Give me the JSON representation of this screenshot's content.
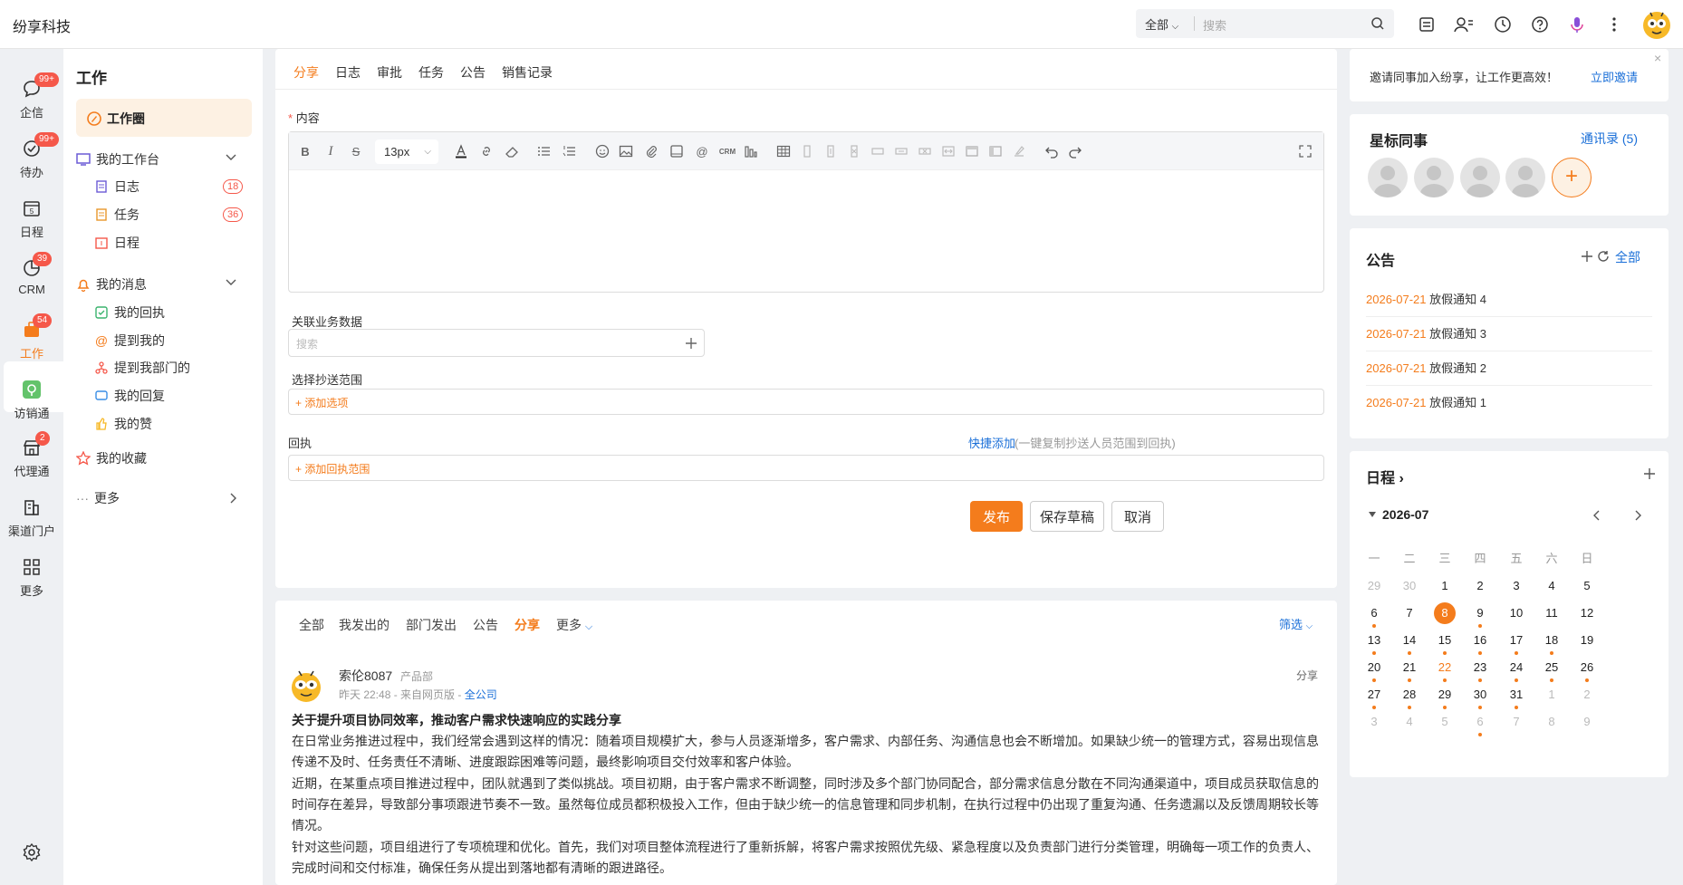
{
  "app": {
    "title": "纷享科技"
  },
  "topbar": {
    "scope": "全部",
    "search_placeholder": "搜索"
  },
  "rail": {
    "items": [
      {
        "label": "企信",
        "badge": "99+"
      },
      {
        "label": "待办",
        "badge": "99+"
      },
      {
        "label": "日程",
        "calendar_day": "5"
      },
      {
        "label": "CRM",
        "badge": "39"
      },
      {
        "label": "工作",
        "badge": "54"
      },
      {
        "label": "访销通"
      },
      {
        "label": "代理通",
        "badge": "2"
      },
      {
        "label": "渠道门户"
      },
      {
        "label": "更多"
      }
    ]
  },
  "subnav": {
    "title": "工作",
    "work_circle": "工作圈",
    "workbench": {
      "label": "我的工作台",
      "items": [
        {
          "label": "日志",
          "count": "18"
        },
        {
          "label": "任务",
          "count": "36"
        },
        {
          "label": "日程"
        }
      ]
    },
    "messages": {
      "label": "我的消息",
      "items": [
        {
          "label": "我的回执"
        },
        {
          "label": "提到我的"
        },
        {
          "label": "提到我部门的"
        },
        {
          "label": "我的回复"
        },
        {
          "label": "我的赞"
        }
      ]
    },
    "favorites": "我的收藏",
    "more_dots": "···",
    "more": "更多"
  },
  "editor": {
    "tabs": [
      "分享",
      "日志",
      "审批",
      "任务",
      "公告",
      "销售记录"
    ],
    "content_required": "*",
    "content_label": "内容",
    "font_size": "13px",
    "crm_label": "CRM",
    "related_label": "关联业务数据",
    "related_placeholder": "搜索",
    "cc_label": "选择抄送范围",
    "cc_add": "+ 添加选项",
    "receipt_label": "回执",
    "quick_add": "快捷添加",
    "quick_add_hint": "(一键复制抄送人员范围到回执)",
    "receipt_add": "+ 添加回执范围",
    "publish": "发布",
    "save_draft": "保存草稿",
    "cancel": "取消"
  },
  "feed": {
    "tabs": [
      "全部",
      "我发出的",
      "部门发出",
      "公告",
      "分享",
      "更多"
    ],
    "filter": "筛选",
    "post": {
      "author": "索伦8087",
      "department": "产品部",
      "meta": "昨天 22:48 - 来自网页版 - ",
      "scope": "全公司",
      "type": "分享",
      "title": "关于提升项目协同效率，推动客户需求快速响应的实践分享",
      "paragraphs": [
        "在日常业务推进过程中，我们经常会遇到这样的情况：随着项目规模扩大，参与人员逐渐增多，客户需求、内部任务、沟通信息也会不断增加。如果缺少统一的管理方式，容易出现信息传递不及时、任务责任不清晰、进度跟踪困难等问题，最终影响项目交付效率和客户体验。",
        "近期，在某重点项目推进过程中，团队就遇到了类似挑战。项目初期，由于客户需求不断调整，同时涉及多个部门协同配合，部分需求信息分散在不同沟通渠道中，项目成员获取信息的时间存在差异，导致部分事项跟进节奏不一致。虽然每位成员都积极投入工作，但由于缺少统一的信息管理和同步机制，在执行过程中仍出现了重复沟通、任务遗漏以及反馈周期较长等情况。",
        "针对这些问题，项目组进行了专项梳理和优化。首先，我们对项目整体流程进行了重新拆解，将客户需求按照优先级、紧急程度以及负责部门进行分类管理，明确每一项工作的负责人、完成时间和交付标准，确保任务从提出到落地都有清晰的跟进路径。"
      ]
    }
  },
  "invite": {
    "text": "邀请同事加入纷享，让工作更高效！",
    "link": "立即邀请",
    "close": "×"
  },
  "starred": {
    "title": "星标同事",
    "contacts": "通讯录 (5)",
    "add": "+"
  },
  "announcements": {
    "title": "公告",
    "all": "全部",
    "items": [
      {
        "date": "2026-07-21",
        "title": "放假通知 4"
      },
      {
        "date": "2026-07-21",
        "title": "放假通知 3"
      },
      {
        "date": "2026-07-21",
        "title": "放假通知 2"
      },
      {
        "date": "2026-07-21",
        "title": "放假通知 1"
      }
    ]
  },
  "schedule": {
    "title": "日程",
    "month": "2026-07",
    "weekdays": [
      "一",
      "二",
      "三",
      "四",
      "五",
      "六",
      "日"
    ],
    "weeks": [
      [
        "29",
        "30",
        "1",
        "2",
        "3",
        "4",
        "5"
      ],
      [
        "6",
        "7",
        "8",
        "9",
        "10",
        "11",
        "12"
      ],
      [
        "13",
        "14",
        "15",
        "16",
        "17",
        "18",
        "19"
      ],
      [
        "20",
        "21",
        "22",
        "23",
        "24",
        "25",
        "26"
      ],
      [
        "27",
        "28",
        "29",
        "30",
        "31",
        "1",
        "2"
      ],
      [
        "3",
        "4",
        "5",
        "6",
        "7",
        "8",
        "9"
      ]
    ],
    "today": "8",
    "highlight_day": "22",
    "event_days": [
      "9",
      "13",
      "14",
      "15",
      "16",
      "17",
      "18",
      "20",
      "21",
      "22",
      "23",
      "24",
      "25",
      "26",
      "27",
      "28",
      "29",
      "30",
      "31",
      "6"
    ]
  },
  "colors": {
    "accent": "#f47c1c",
    "link": "#1a6fd8",
    "badge": "#f5584a"
  }
}
